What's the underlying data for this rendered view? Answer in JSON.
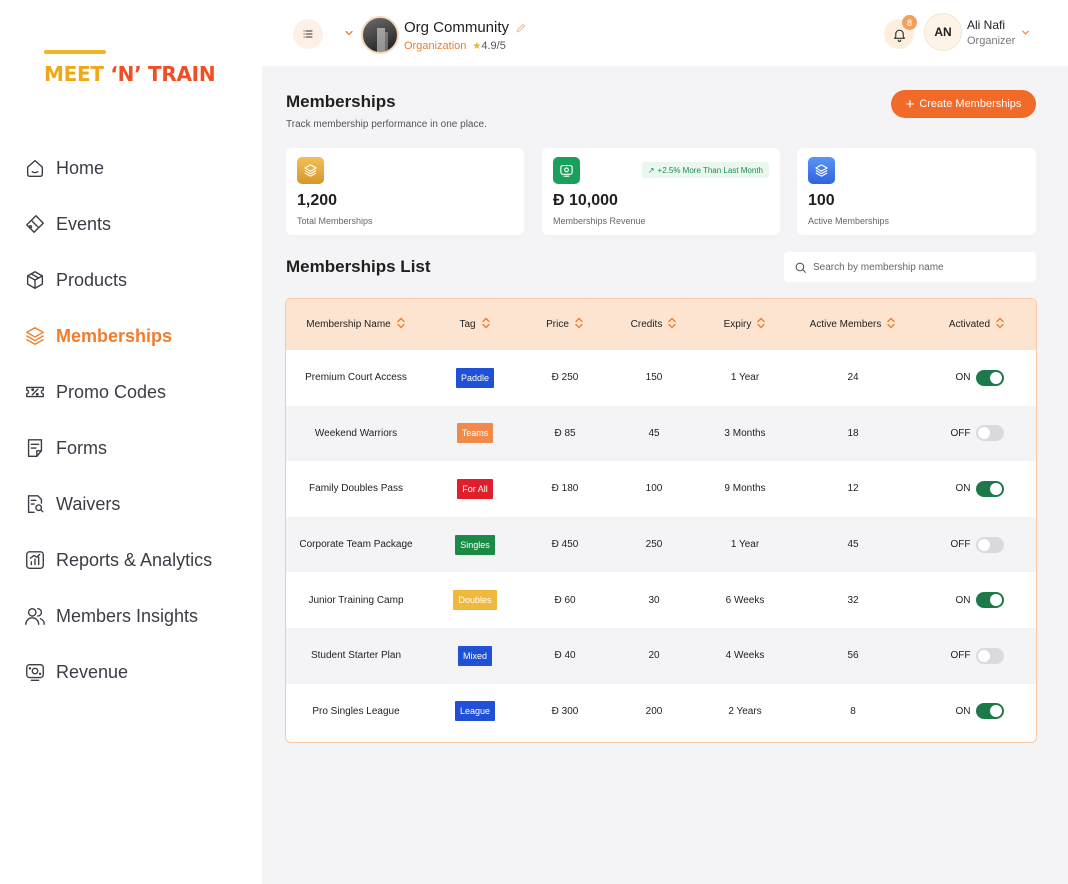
{
  "brand": {
    "part1": "MEET ",
    "part2": "‘N’",
    "part3": " TRAIN"
  },
  "sidebar": {
    "items": [
      {
        "label": "Home",
        "icon": "home-icon",
        "active": false
      },
      {
        "label": "Events",
        "icon": "events-icon",
        "active": false
      },
      {
        "label": "Products",
        "icon": "box-icon",
        "active": false
      },
      {
        "label": "Memberships",
        "icon": "layers-icon",
        "active": true
      },
      {
        "label": "Promo Codes",
        "icon": "ticket-icon",
        "active": false
      },
      {
        "label": "Forms",
        "icon": "form-icon",
        "active": false
      },
      {
        "label": "Waivers",
        "icon": "document-search-icon",
        "active": false
      },
      {
        "label": "Reports & Analytics",
        "icon": "chart-icon",
        "active": false
      },
      {
        "label": "Members Insights",
        "icon": "users-icon",
        "active": false
      },
      {
        "label": "Revenue",
        "icon": "revenue-icon",
        "active": false
      }
    ]
  },
  "header": {
    "org_name": "Org Community",
    "org_role": "Organization",
    "org_rating": "4.9/5",
    "notification_count": "8",
    "user_initials": "AN",
    "user_name": "Ali Nafi",
    "user_role": "Organizer"
  },
  "page": {
    "title": "Memberships",
    "subtitle": "Track membership performance in one place.",
    "create_label": "Create Memberships",
    "list_title": "Memberships List",
    "search_placeholder": "Search by membership name"
  },
  "stats": [
    {
      "value": "1,200",
      "label": "Total Memberships",
      "icon": "layers-icon",
      "color": "#e2a53c"
    },
    {
      "value": "Đ 10,000",
      "label": "Memberships Revenue",
      "icon": "revenue-icon",
      "color": "#19a05a",
      "trend": "+2.5% More Than Last Month"
    },
    {
      "value": "100",
      "label": "Active Memberships",
      "icon": "layers-icon",
      "color": "#3a7bea"
    }
  ],
  "table": {
    "columns": [
      "Membership Name",
      "Tag",
      "Price",
      "Credits",
      "Expiry",
      "Active Members",
      "Activated"
    ],
    "rows": [
      {
        "name": "Premium Court Access",
        "tag": "Paddle",
        "tag_color": "#1f50d6",
        "price": "Đ 250",
        "credits": "150",
        "expiry": "1 Year",
        "active": "24",
        "activated": "ON"
      },
      {
        "name": "Weekend Warriors",
        "tag": "Teams",
        "tag_color": "#f08a4b",
        "price": "Đ 85",
        "credits": "45",
        "expiry": "3 Months",
        "active": "18",
        "activated": "OFF"
      },
      {
        "name": "Family Doubles Pass",
        "tag": "For All",
        "tag_color": "#e01f2a",
        "price": "Đ 180",
        "credits": "100",
        "expiry": "9 Months",
        "active": "12",
        "activated": "ON"
      },
      {
        "name": "Corporate Team Package",
        "tag": "Singles",
        "tag_color": "#1a8a45",
        "price": "Đ 450",
        "credits": "250",
        "expiry": "1 Year",
        "active": "45",
        "activated": "OFF"
      },
      {
        "name": "Junior Training Camp",
        "tag": "Doubles",
        "tag_color": "#f0b93c",
        "price": "Đ 60",
        "credits": "30",
        "expiry": "6 Weeks",
        "active": "32",
        "activated": "ON"
      },
      {
        "name": "Student Starter Plan",
        "tag": "Mixed",
        "tag_color": "#1f50d6",
        "price": "Đ 40",
        "credits": "20",
        "expiry": "4 Weeks",
        "active": "56",
        "activated": "OFF"
      },
      {
        "name": "Pro Singles League",
        "tag": "League",
        "tag_color": "#1f50d6",
        "price": "Đ 300",
        "credits": "200",
        "expiry": "2 Years",
        "active": "8",
        "activated": "ON"
      }
    ]
  }
}
